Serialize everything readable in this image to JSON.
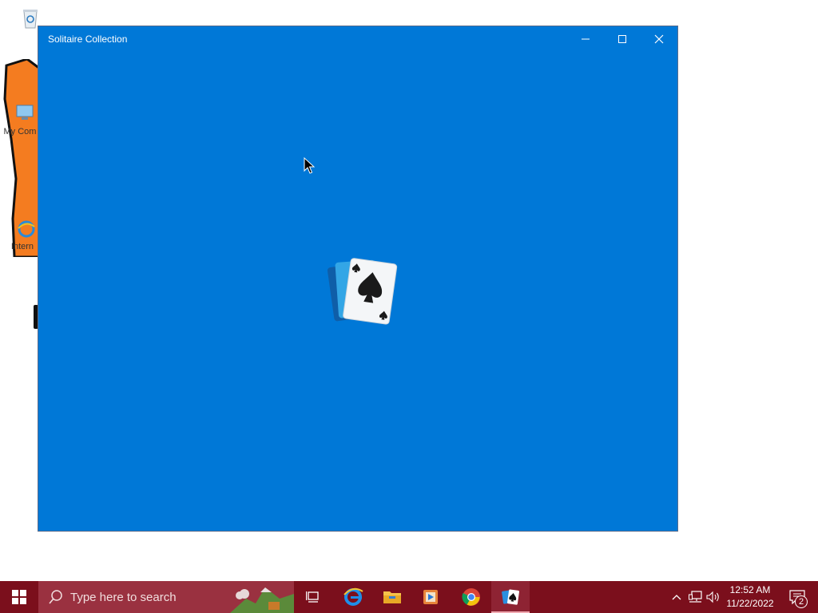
{
  "desktop": {
    "icons": [
      {
        "name": "recycle-bin"
      },
      {
        "label": "My Com"
      },
      {
        "label": "Intern"
      }
    ]
  },
  "window": {
    "title": "Solitaire Collection",
    "controls": {
      "minimize": "minimize-icon",
      "maximize": "maximize-icon",
      "close": "close-icon"
    },
    "background_color": "#0078d7",
    "splash_icon": "solitaire-spade-card-icon"
  },
  "taskbar": {
    "background_color": "#7b0f1c",
    "search": {
      "placeholder": "Type here to search"
    },
    "pinned": [
      {
        "name": "task-view-icon"
      },
      {
        "name": "edge-icon"
      },
      {
        "name": "file-explorer-icon"
      },
      {
        "name": "media-player-icon"
      },
      {
        "name": "chrome-icon"
      },
      {
        "name": "solitaire-icon",
        "active": true
      }
    ],
    "tray": {
      "icons": [
        "chevron-up-icon",
        "network-icon",
        "volume-icon"
      ],
      "time": "12:52 AM",
      "date": "11/22/2022",
      "notification_count": "2"
    }
  }
}
